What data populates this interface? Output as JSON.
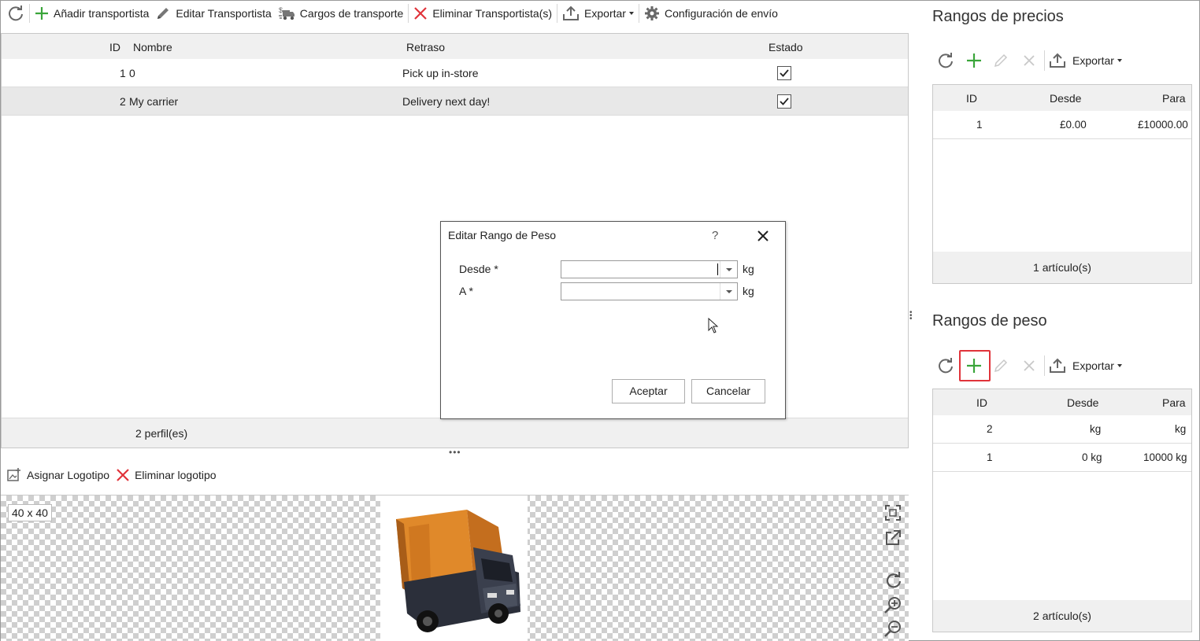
{
  "toolbar": {
    "items": [
      {
        "label": "Añadir transportista",
        "icon": "plus-icon"
      },
      {
        "label": "Editar Transportista",
        "icon": "pencil-icon"
      },
      {
        "label": "Cargos de transporte",
        "icon": "shipping-cost-icon"
      },
      {
        "label": "Eliminar Transportista(s)",
        "icon": "delete-icon"
      },
      {
        "label": "Exportar",
        "icon": "export-icon"
      },
      {
        "label": "Configuración de envío",
        "icon": "gear-icon"
      }
    ]
  },
  "carriers_grid": {
    "columns": [
      "ID",
      "Nombre",
      "Retraso",
      "Estado"
    ],
    "rows": [
      {
        "id": "1",
        "name": "0",
        "delay": "Pick up in-store",
        "enabled": true
      },
      {
        "id": "2",
        "name": "My carrier",
        "delay": "Delivery next day!",
        "enabled": true
      }
    ],
    "footer": "2 perfil(es)"
  },
  "logo_toolbar": {
    "assign": "Asignar Logotipo",
    "remove": "Eliminar logotipo"
  },
  "image_preview": {
    "size": "40 x 40"
  },
  "dialog": {
    "title": "Editar Rango de Peso",
    "help": "?",
    "from_label": "Desde *",
    "to_label": "A *",
    "from_value": "",
    "to_value": "",
    "unit": "kg",
    "ok": "Aceptar",
    "cancel": "Cancelar"
  },
  "price_ranges": {
    "title": "Rangos de precios",
    "export": "Exportar",
    "columns": [
      "ID",
      "Desde",
      "Para"
    ],
    "rows": [
      {
        "id": "1",
        "from": "£0.00",
        "to": "£10000.00"
      }
    ],
    "footer": "1 artículo(s)"
  },
  "weight_ranges": {
    "title": "Rangos de peso",
    "export": "Exportar",
    "columns": [
      "ID",
      "Desde",
      "Para"
    ],
    "rows": [
      {
        "id": "2",
        "from": "kg",
        "to": "kg"
      },
      {
        "id": "1",
        "from": "0 kg",
        "to": "10000 kg"
      }
    ],
    "footer": "2 artículo(s)"
  },
  "colors": {
    "accent_green": "#3aa53a",
    "delete_red": "#e0333a",
    "highlight": "#e0333a"
  }
}
